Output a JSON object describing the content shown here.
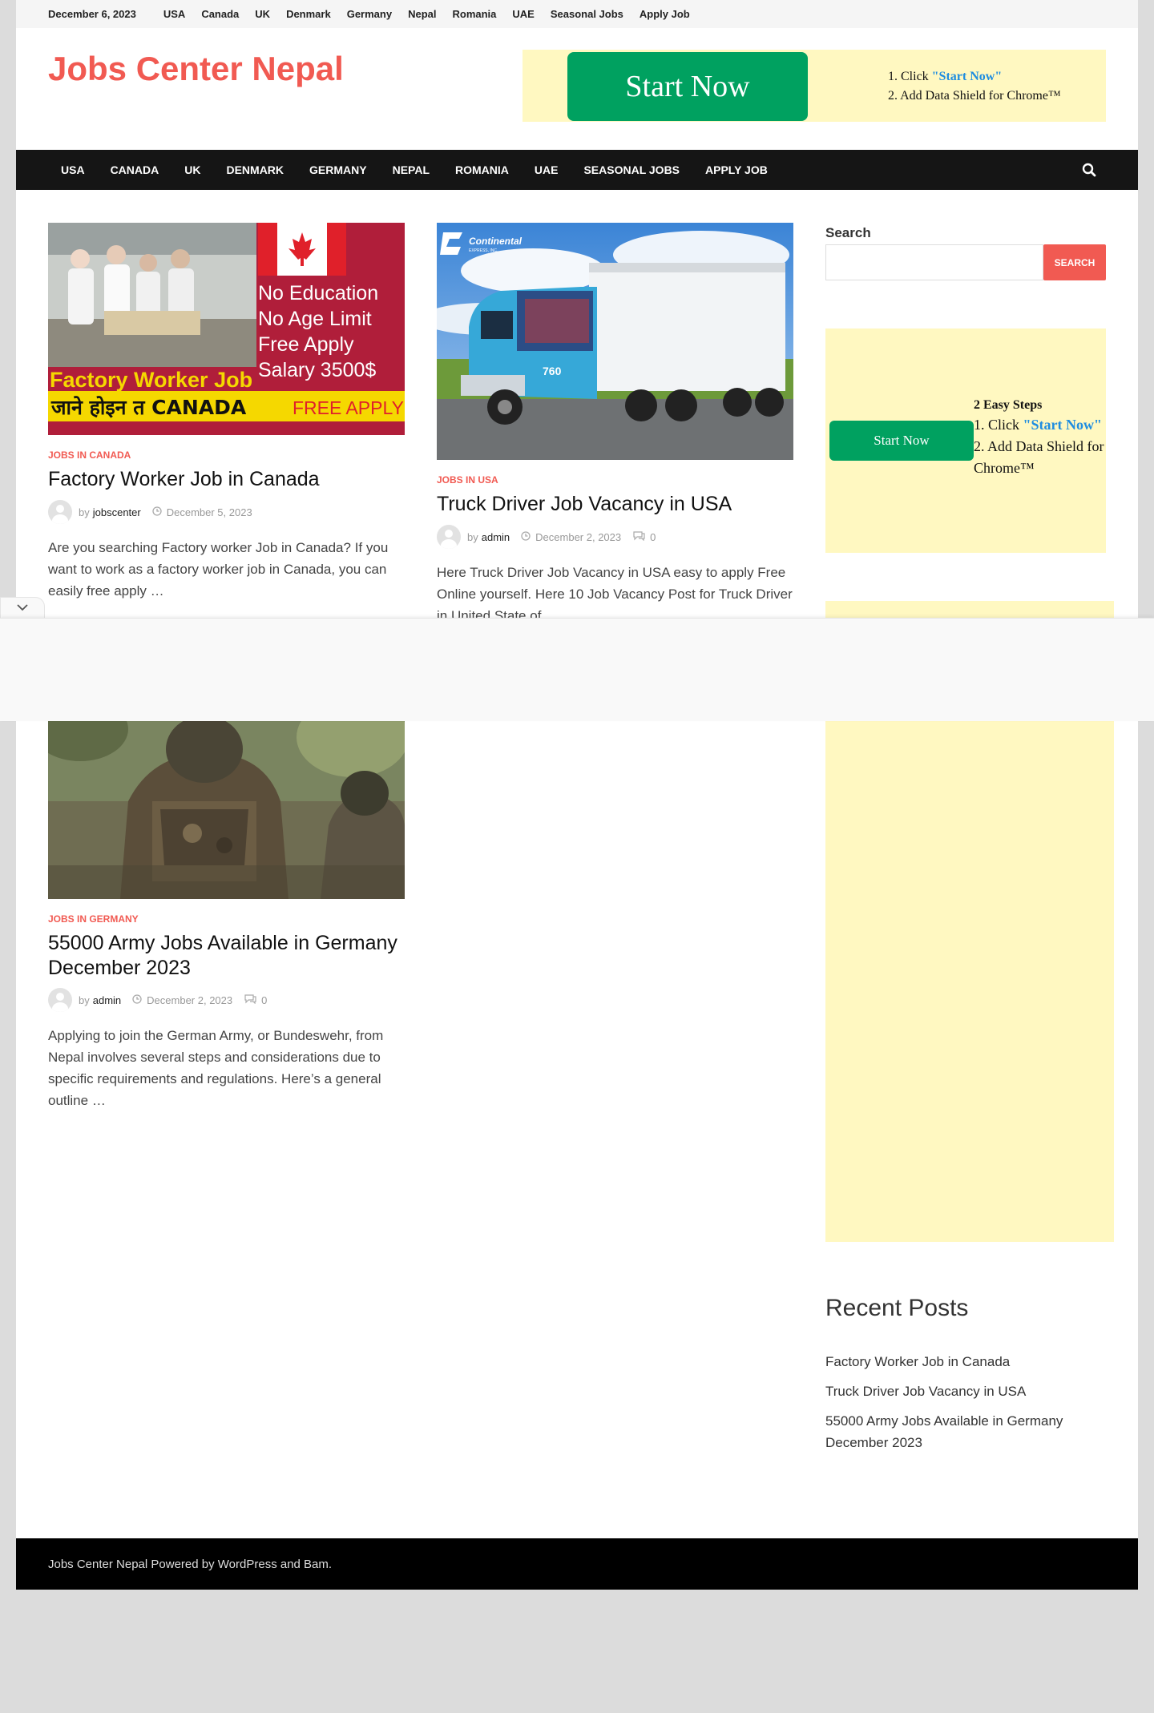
{
  "topbar": {
    "date": "December 6, 2023",
    "links": [
      "USA",
      "Canada",
      "UK",
      "Denmark",
      "Germany",
      "Nepal",
      "Romania",
      "UAE",
      "Seasonal Jobs",
      "Apply Job"
    ]
  },
  "site": {
    "title": "Jobs Center Nepal"
  },
  "header_ad": {
    "button": "Start Now",
    "step1_prefix": "1. Click ",
    "step1_link": "\"Start Now\"",
    "step2": "2. Add Data Shield for Chrome™"
  },
  "nav": {
    "items": [
      "USA",
      "CANADA",
      "UK",
      "DENMARK",
      "GERMANY",
      "NEPAL",
      "ROMANIA",
      "UAE",
      "SEASONAL JOBS",
      "APPLY JOB"
    ],
    "search_icon": "search-icon"
  },
  "posts": [
    {
      "category": "JOBS IN CANADA",
      "title": "Factory Worker Job in Canada",
      "by": "by",
      "author": "jobscenter",
      "date": "December 5, 2023",
      "excerpt": "Are you searching Factory worker Job in Canada? If you want to work as a factory worker job in Canada, you can easily free apply …",
      "image": {
        "line1": "No Education",
        "line2": "No Age Limit",
        "line3": "Free Apply",
        "line4": "Salary 3500$",
        "banner": "Factory Worker Job",
        "bottom_left": "जाने होइन त CANADA",
        "bottom_right": "FREE APPLY"
      }
    },
    {
      "category": "JOBS IN USA",
      "title": "Truck Driver Job Vacancy in USA",
      "by": "by",
      "author": "admin",
      "date": "December 2, 2023",
      "comments": "0",
      "excerpt": "Here Truck Driver Job Vacancy in USA easy to apply Free Online yourself. Here 10 Job Vacancy Post for Truck Driver in United State of …",
      "image": {
        "logo": "Continental",
        "logo_sub": "EXPRESS, INC.",
        "truck_no": "760"
      }
    },
    {
      "category": "JOBS IN GERMANY",
      "title": "55000 Army Jobs Available in Germany December 2023",
      "by": "by",
      "author": "admin",
      "date": "December 2, 2023",
      "comments": "0",
      "excerpt": "Applying to join the German Army, or Bundeswehr, from Nepal involves several steps and considerations due to specific requirements and regulations. Here’s a general outline …"
    }
  ],
  "sidebar": {
    "search_label": "Search",
    "search_value": "",
    "search_button": "SEARCH",
    "ad": {
      "button": "Start Now",
      "heading": "2 Easy Steps",
      "step1_prefix": "1. Click ",
      "step1_link": "\"Start Now\"",
      "step2": "2. Add Data Shield for Chrome™"
    },
    "recent_title": "Recent Posts",
    "recent": [
      "Factory Worker Job in Canada",
      "Truck Driver Job Vacancy in USA",
      "55000 Army Jobs Available in Germany December 2023"
    ]
  },
  "footer": {
    "text": "Jobs Center Nepal Powered by WordPress and Bam."
  },
  "colors": {
    "accent": "#f15a52",
    "nav_bg": "#151515",
    "ad_bg": "#fff8c1",
    "ad_button": "#00a160",
    "link_blue": "#1f8de0"
  }
}
